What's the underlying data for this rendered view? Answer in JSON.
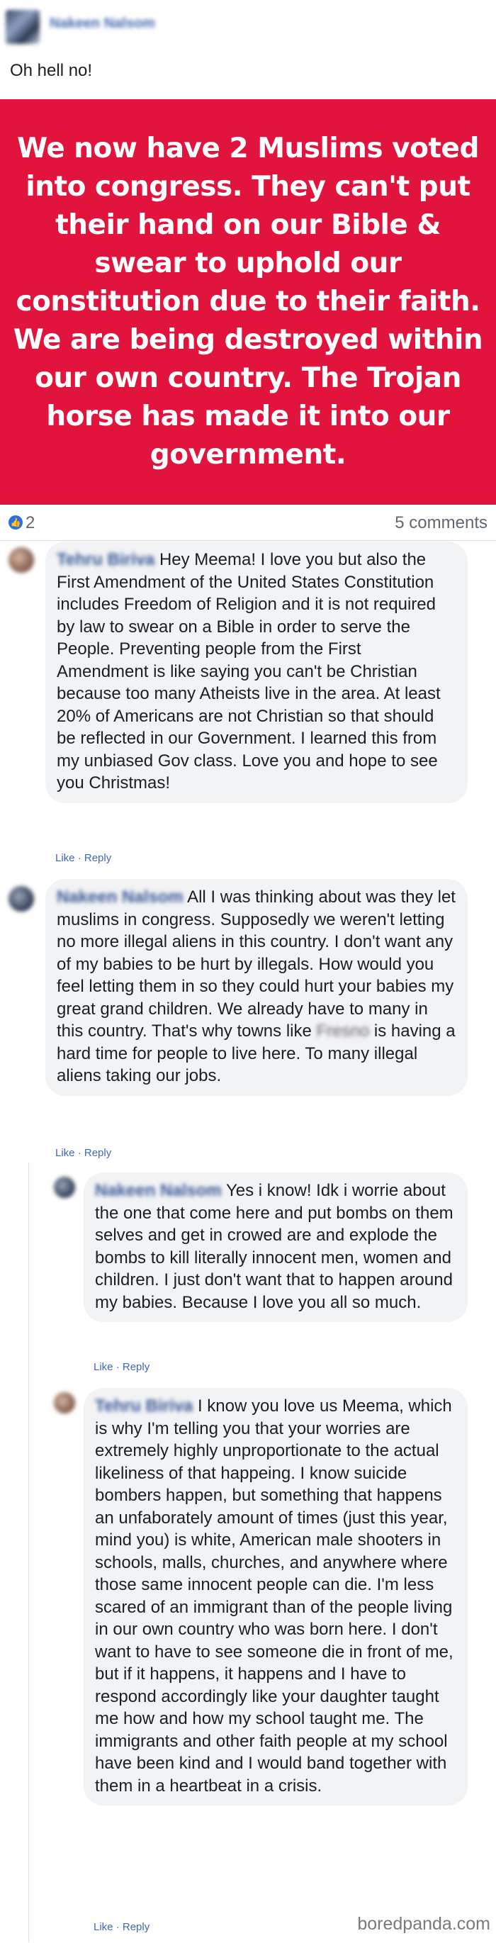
{
  "post": {
    "author": "Nakeen Nalsom",
    "text": "Oh hell no!",
    "banner": "We now have 2 Muslims voted into congress. They can't put their hand on our Bible & swear to uphold our constitution due to their faith. We are being destroyed within our own country. The Trojan horse has made it into our government."
  },
  "stats": {
    "likes": "2",
    "comments": "5 comments"
  },
  "comments": [
    {
      "author": "Tehru Biriva",
      "text": "Hey Meema! I love you but also the First Amendment of the United States Constitution includes Freedom of Religion and it is not required by law to swear on a Bible in order to serve the People. Preventing people from the First Amendment is like saying you can't be Christian because too many Atheists live in the area. At least 20% of Americans are not Christian so that should be reflected in our Government. I learned this from my unbiased Gov class. Love you and hope to see you Christmas!",
      "like": "Like",
      "reply": "Reply"
    },
    {
      "author": "Nakeen Nalsom",
      "text_before": "All I was thinking about was they let muslims in congress. Supposedly we weren't letting no more illegal aliens in this country. I don't want any of my babies to be hurt by illegals. How would you feel letting them in so they could hurt your babies my great grand children. We already have to many in this country. That's why towns like",
      "town": "Fresno",
      "text_after": "is having a hard time for people to live here. To many illegal aliens taking our jobs.",
      "like": "Like",
      "reply": "Reply"
    },
    {
      "author": "Nakeen Nalsom",
      "text": "Yes i know! Idk i worrie about the one that come here and put bombs on them selves and get in crowed are and explode the bombs to kill literally innocent men, women and children. I just don't want that to happen around my babies. Because I love you all so much.",
      "like": "Like",
      "reply": "Reply"
    },
    {
      "author": "Tehru Biriva",
      "text": "I know you love us Meema, which is why I'm telling you that your worries are extremely highly unproportionate to the actual likeliness of that happeing. I know suicide bombers happen, but something that happens an unfaborately amount of times (just this year, mind you) is white, American male shooters in schools, malls, churches, and anywhere where those same innocent people can die. I'm less scared of an immigrant than of the people living in our own country who was born here. I don't want to have to see someone die in front of me, but if it happens, it happens and I have to respond accordingly like your daughter taught me how and how my school taught me. The immigrants and other faith people at my school have been kind and I would band together with them in a heartbeat in a crisis.",
      "like": "Like",
      "reply": "Reply"
    }
  ],
  "watermark": "boredpanda.com",
  "colors": {
    "banner": "#e0143c",
    "link": "#385898",
    "bubble": "#f2f3f5"
  }
}
